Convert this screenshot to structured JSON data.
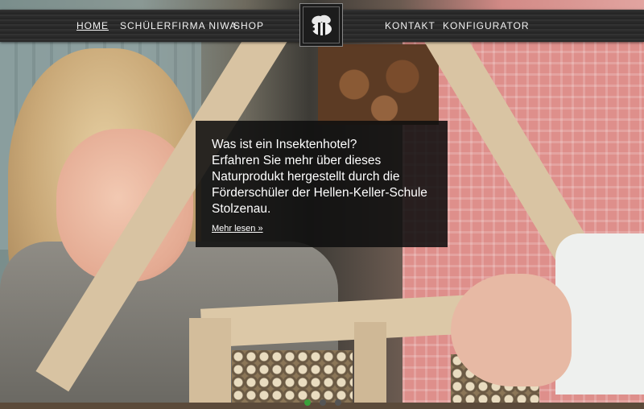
{
  "nav": {
    "left_items": [
      {
        "label": "HOME",
        "active": true
      },
      {
        "label": "SCHÜLERFIRMA NIWA",
        "active": false
      },
      {
        "label": "SHOP",
        "active": false
      }
    ],
    "right_items": [
      {
        "label": "KONTAKT",
        "active": false
      },
      {
        "label": "KONFIGURATOR",
        "active": false
      }
    ],
    "logo_icon": "bee-logo-icon"
  },
  "slide": {
    "title": "Was ist ein Insektenhotel?",
    "body": "Erfahren Sie mehr über dieses Naturprodukt hergestellt durch die Förderschüler der Hellen-Keller-Schule Stolzenau.",
    "link_label": "Mehr lesen »"
  },
  "slider": {
    "total_dots": 3,
    "active_index": 0
  },
  "colors": {
    "nav_bg": "#2a2a2a",
    "caption_bg": "#0f0f0f",
    "active_dot": "#3aa03a"
  }
}
